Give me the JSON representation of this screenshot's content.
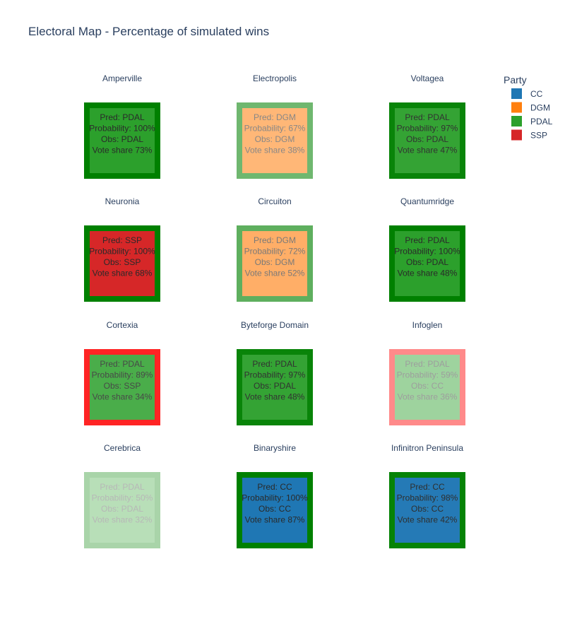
{
  "chart_data": {
    "type": "table",
    "title": "Electoral Map - Percentage of simulated wins",
    "legend": {
      "title": "Party",
      "placement": "top-right",
      "items": [
        {
          "name": "CC",
          "color": "#1f77b4"
        },
        {
          "name": "DGM",
          "color": "#ff7f0e"
        },
        {
          "name": "PDAL",
          "color": "#2ca02c"
        },
        {
          "name": "SSP",
          "color": "#d62728"
        }
      ]
    },
    "status_colors": {
      "correct": "#008000",
      "incorrect": "#ff0000"
    },
    "regions": [
      {
        "name": "Amperville",
        "pred": "PDAL",
        "probability": 100,
        "obs": "PDAL",
        "vote_share": 73,
        "lines": [
          "Pred: PDAL",
          "Probability: 100%",
          "Obs: PDAL",
          "Vote share 73%"
        ]
      },
      {
        "name": "Electropolis",
        "pred": "DGM",
        "probability": 67,
        "obs": "DGM",
        "vote_share": 38,
        "lines": [
          "Pred: DGM",
          "Probability: 67%",
          "Obs: DGM",
          "Vote share 38%"
        ]
      },
      {
        "name": "Voltagea",
        "pred": "PDAL",
        "probability": 97,
        "obs": "PDAL",
        "vote_share": 47,
        "lines": [
          "Pred: PDAL",
          "Probability: 97%",
          "Obs: PDAL",
          "Vote share 47%"
        ]
      },
      {
        "name": "Neuronia",
        "pred": "SSP",
        "probability": 100,
        "obs": "SSP",
        "vote_share": 68,
        "lines": [
          "Pred: SSP",
          "Probability: 100%",
          "Obs: SSP",
          "Vote share 68%"
        ]
      },
      {
        "name": "Circuiton",
        "pred": "DGM",
        "probability": 72,
        "obs": "DGM",
        "vote_share": 52,
        "lines": [
          "Pred: DGM",
          "Probability: 72%",
          "Obs: DGM",
          "Vote share 52%"
        ]
      },
      {
        "name": "Quantumridge",
        "pred": "PDAL",
        "probability": 100,
        "obs": "PDAL",
        "vote_share": 48,
        "lines": [
          "Pred: PDAL",
          "Probability: 100%",
          "Obs: PDAL",
          "Vote share 48%"
        ]
      },
      {
        "name": "Cortexia",
        "pred": "PDAL",
        "probability": 89,
        "obs": "SSP",
        "vote_share": 34,
        "lines": [
          "Pred: PDAL",
          "Probability: 89%",
          "Obs: SSP",
          "Vote share 34%"
        ]
      },
      {
        "name": "Byteforge Domain",
        "pred": "PDAL",
        "probability": 97,
        "obs": "PDAL",
        "vote_share": 48,
        "lines": [
          "Pred: PDAL",
          "Probability: 97%",
          "Obs: PDAL",
          "Vote share 48%"
        ]
      },
      {
        "name": "Infoglen",
        "pred": "PDAL",
        "probability": 59,
        "obs": "CC",
        "vote_share": 36,
        "lines": [
          "Pred: PDAL",
          "Probability: 59%",
          "Obs: CC",
          "Vote share 36%"
        ]
      },
      {
        "name": "Cerebrica",
        "pred": "PDAL",
        "probability": 50,
        "obs": "PDAL",
        "vote_share": 32,
        "lines": [
          "Pred: PDAL",
          "Probability: 50%",
          "Obs: PDAL",
          "Vote share 32%"
        ]
      },
      {
        "name": "Binaryshire",
        "pred": "CC",
        "probability": 100,
        "obs": "CC",
        "vote_share": 87,
        "lines": [
          "Pred: CC",
          "Probability: 100%",
          "Obs: CC",
          "Vote share 87%"
        ]
      },
      {
        "name": "Infinitron Peninsula",
        "pred": "CC",
        "probability": 98,
        "obs": "CC",
        "vote_share": 42,
        "lines": [
          "Pred: CC",
          "Probability: 98%",
          "Obs: CC",
          "Vote share 42%"
        ]
      }
    ]
  }
}
